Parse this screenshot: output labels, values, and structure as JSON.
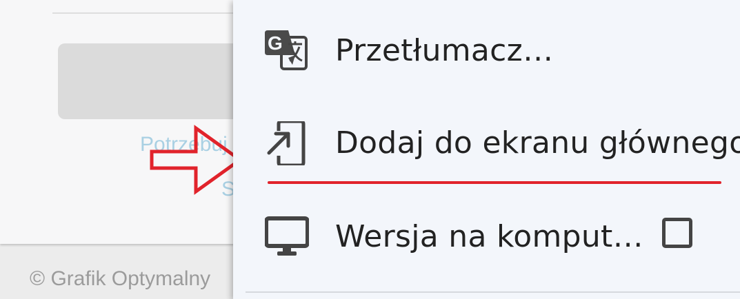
{
  "background_page": {
    "link_line1": "Potrzebuj",
    "link_line2": "S",
    "footer": "© Grafik Optymalny"
  },
  "menu": {
    "items": [
      {
        "id": "translate",
        "label": "Przetłumacz…",
        "icon": "google-translate-icon"
      },
      {
        "id": "add-to-home",
        "label": "Dodaj do ekranu głównego",
        "icon": "add-to-home-screen-icon"
      },
      {
        "id": "desktop-site",
        "label": "Wersja na komput…",
        "icon": "desktop-monitor-icon",
        "checked": false
      }
    ]
  },
  "colors": {
    "annotation_red": "#e1232b",
    "menu_background": "#f3f6fb",
    "link_color": "#a9d0e3",
    "icon_color": "#444444"
  }
}
